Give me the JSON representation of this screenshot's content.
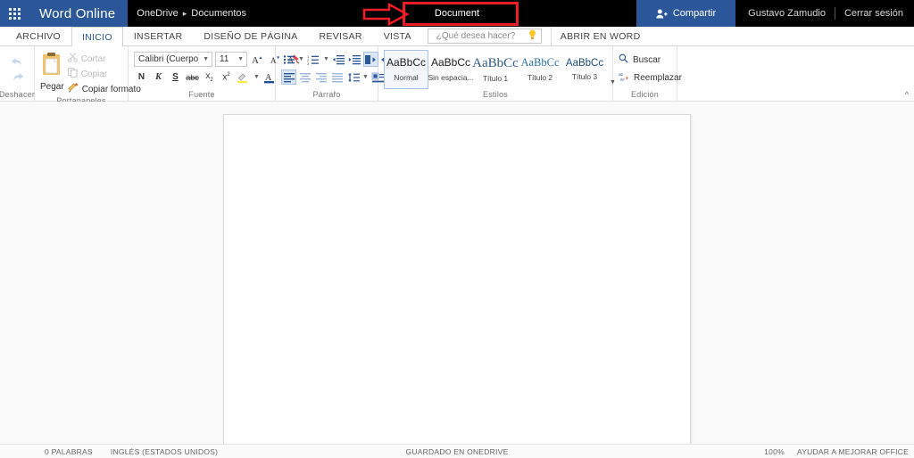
{
  "header": {
    "app_launcher_icon": "waffle-grid-icon",
    "brand": "Word Online",
    "breadcrumb_root": "OneDrive",
    "breadcrumb_separator": "▸",
    "breadcrumb_folder": "Documentos",
    "document_title": "Document",
    "share_label": "Compartir",
    "share_icon": "person-add-icon",
    "user_name": "Gustavo Zamudio",
    "sign_out": "Cerrar sesión",
    "brand_color": "#2b579a",
    "bar_color": "#000000",
    "annotation_color": "#ee1c24"
  },
  "tabs": [
    {
      "label": "ARCHIVO",
      "active": false
    },
    {
      "label": "INICIO",
      "active": true
    },
    {
      "label": "INSERTAR",
      "active": false
    },
    {
      "label": "DISEÑO DE PÁGINA",
      "active": false
    },
    {
      "label": "REVISAR",
      "active": false
    },
    {
      "label": "VISTA",
      "active": false
    }
  ],
  "tellme": {
    "placeholder": "¿Qué desea hacer?",
    "value": "",
    "icon": "lightbulb-icon"
  },
  "open_in_word": "ABRIR EN WORD",
  "ribbon": {
    "undo": {
      "label": "Deshacer",
      "undo_icon": "undo-arrow-icon",
      "redo_icon": "redo-arrow-icon"
    },
    "clipboard": {
      "label": "Portapapeles",
      "paste_label": "Pegar",
      "paste_icon": "clipboard-icon",
      "commands": [
        {
          "label": "Cortar",
          "icon": "scissors-icon",
          "disabled": true
        },
        {
          "label": "Copiar",
          "icon": "copy-icon",
          "disabled": true
        },
        {
          "label": "Copiar formato",
          "icon": "format-painter-icon",
          "disabled": false
        }
      ]
    },
    "font": {
      "label": "Fuente",
      "family_value": "Calibri (Cuerpo)",
      "size_value": "11",
      "grow_icon": "grow-font-icon",
      "shrink_icon": "shrink-font-icon",
      "clear_format_icon": "clear-formatting-icon",
      "bold": "N",
      "italic": "K",
      "underline": "S",
      "strikethrough": "abc",
      "subscript": "x",
      "superscript": "x",
      "highlight_icon": "text-highlight-icon",
      "fontcolor_icon": "font-color-icon"
    },
    "paragraph": {
      "label": "Párrafo",
      "row1": [
        {
          "icon": "bullets-icon",
          "selected": false,
          "caret": true
        },
        {
          "icon": "numbering-icon",
          "selected": false,
          "caret": true
        },
        {
          "icon": "decrease-indent-icon",
          "selected": false,
          "caret": false
        },
        {
          "icon": "increase-indent-icon",
          "selected": false,
          "caret": false
        },
        {
          "icon": "ltr-text-direction-icon",
          "selected": true,
          "caret": false
        },
        {
          "icon": "rtl-text-direction-icon",
          "selected": false,
          "caret": false
        }
      ],
      "row2": [
        {
          "icon": "align-left-icon",
          "selected": true,
          "caret": false
        },
        {
          "icon": "align-center-icon",
          "selected": false,
          "caret": false
        },
        {
          "icon": "align-right-icon",
          "selected": false,
          "caret": false
        },
        {
          "icon": "justify-icon",
          "selected": false,
          "caret": false
        },
        {
          "icon": "line-spacing-icon",
          "selected": false,
          "caret": true
        },
        {
          "icon": "shading-icon",
          "selected": false,
          "caret": true
        }
      ]
    },
    "styles": {
      "label": "Estilos",
      "more_icon": "more-styles-caret-icon",
      "items": [
        {
          "preview": "AaBbCc",
          "name": "Normal",
          "selected": true
        },
        {
          "preview": "AaBbCc",
          "name": "Sin espacia...",
          "selected": false
        },
        {
          "preview": "AaBbCc",
          "name": "Título 1",
          "selected": false
        },
        {
          "preview": "AaBbCc",
          "name": "Título 2",
          "selected": false
        },
        {
          "preview": "AaBbCc",
          "name": "Título 3",
          "selected": false
        }
      ]
    },
    "editing": {
      "label": "Edición",
      "find_label": "Buscar",
      "find_icon": "search-icon",
      "replace_label": "Reemplazar",
      "replace_icon": "replace-icon"
    },
    "collapse_icon": "collapse-ribbon-icon"
  },
  "document": {
    "body_text": ""
  },
  "status": {
    "word_count": "0 PALABRAS",
    "language": "INGLÉS (ESTADOS UNIDOS)",
    "save_state": "GUARDADO EN ONEDRIVE",
    "zoom": "100%",
    "feedback": "AYUDAR A MEJORAR OFFICE"
  }
}
